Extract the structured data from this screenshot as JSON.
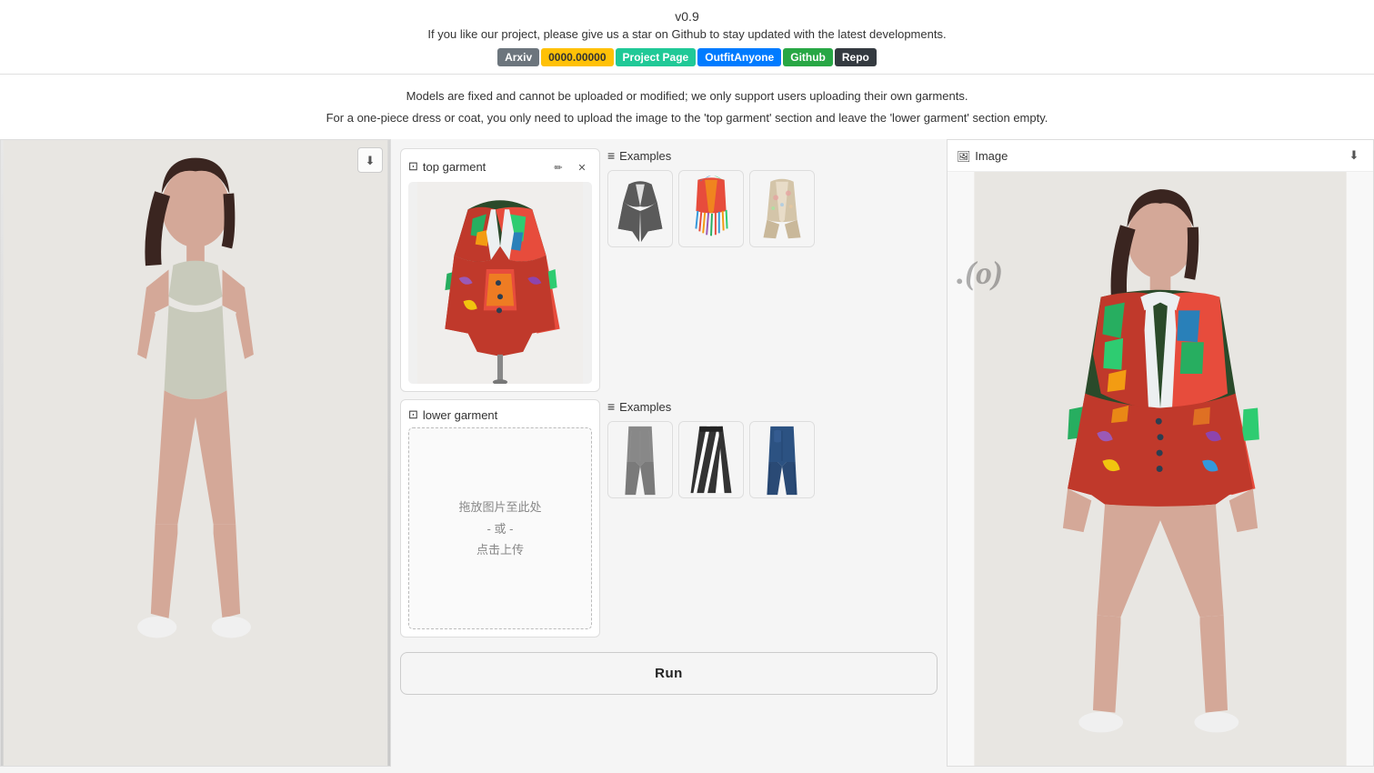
{
  "header": {
    "version": "v0.9",
    "subtitle": "If you like our project, please give us a star on Github to stay updated with the latest developments.",
    "badges": [
      {
        "label": "Arxiv",
        "class": "badge-gray"
      },
      {
        "label": "0000.00000",
        "class": "badge-yellow"
      },
      {
        "label": "Project Page",
        "class": "badge-teal"
      },
      {
        "label": "OutfitAnyone",
        "class": "badge-blue"
      },
      {
        "label": "Github",
        "class": "badge-green"
      },
      {
        "label": "Repo",
        "class": "badge-dark"
      }
    ]
  },
  "info": {
    "line1": "Models are fixed and cannot be uploaded or modified; we only support users uploading their own garments.",
    "line2": "For a one-piece dress or coat, you only need to upload the image to the 'top garment' section and leave the 'lower garment' section empty."
  },
  "top_garment": {
    "label": "top garment",
    "has_image": true,
    "edit_label": "edit",
    "close_label": "close"
  },
  "lower_garment": {
    "label": "lower garment",
    "upload_text_line1": "拖放图片至此处",
    "upload_text_line2": "- 或 -",
    "upload_text_line3": "点击上传"
  },
  "top_examples": {
    "label": "Examples",
    "items": [
      {
        "id": "top-ex-1",
        "desc": "gray knit jacket"
      },
      {
        "id": "top-ex-2",
        "desc": "colorful fringe vest"
      },
      {
        "id": "top-ex-3",
        "desc": "beige blouse"
      }
    ]
  },
  "lower_examples": {
    "label": "Examples",
    "items": [
      {
        "id": "bot-ex-1",
        "desc": "gray trousers"
      },
      {
        "id": "bot-ex-2",
        "desc": "black white stripe skirt"
      },
      {
        "id": "bot-ex-3",
        "desc": "blue jeans"
      }
    ]
  },
  "output": {
    "label": "Image",
    "download_label": "download"
  },
  "run_button": {
    "label": "Run"
  }
}
